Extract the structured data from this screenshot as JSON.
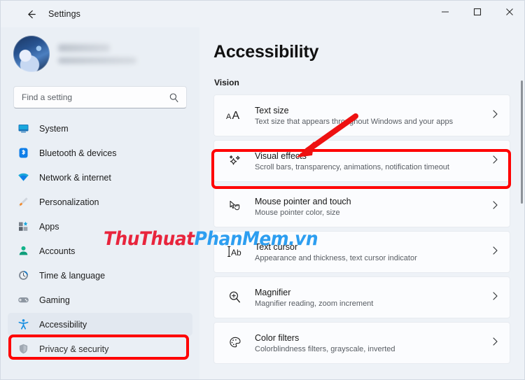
{
  "window": {
    "title": "Settings",
    "back_icon": "back-arrow-icon",
    "minimize": "─",
    "maximize": "□",
    "close": "✕"
  },
  "sidebar": {
    "profile": {
      "name": "",
      "email": "",
      "avatar": "user-avatar"
    },
    "search": {
      "placeholder": "Find a setting",
      "value": "",
      "icon": "search-icon"
    },
    "items": [
      {
        "label": "System",
        "icon": "monitor-icon",
        "selected": false
      },
      {
        "label": "Bluetooth & devices",
        "icon": "bluetooth-icon",
        "selected": false
      },
      {
        "label": "Network & internet",
        "icon": "wifi-icon",
        "selected": false
      },
      {
        "label": "Personalization",
        "icon": "paintbrush-icon",
        "selected": false
      },
      {
        "label": "Apps",
        "icon": "apps-icon",
        "selected": false
      },
      {
        "label": "Accounts",
        "icon": "person-icon",
        "selected": false
      },
      {
        "label": "Time & language",
        "icon": "clock-icon",
        "selected": false
      },
      {
        "label": "Gaming",
        "icon": "gamepad-icon",
        "selected": false
      },
      {
        "label": "Accessibility",
        "icon": "accessibility-icon",
        "selected": true
      },
      {
        "label": "Privacy & security",
        "icon": "shield-icon",
        "selected": false
      }
    ]
  },
  "main": {
    "page_title": "Accessibility",
    "section_label": "Vision",
    "cards": [
      {
        "title": "Text size",
        "subtitle": "Text size that appears throughout Windows and your apps",
        "icon": "text-size-icon"
      },
      {
        "title": "Visual effects",
        "subtitle": "Scroll bars, transparency, animations, notification timeout",
        "icon": "sparkles-icon"
      },
      {
        "title": "Mouse pointer and touch",
        "subtitle": "Mouse pointer color, size",
        "icon": "mouse-pointer-icon"
      },
      {
        "title": "Text cursor",
        "subtitle": "Appearance and thickness, text cursor indicator",
        "icon": "text-cursor-icon"
      },
      {
        "title": "Magnifier",
        "subtitle": "Magnifier reading, zoom increment",
        "icon": "magnifier-icon"
      },
      {
        "title": "Color filters",
        "subtitle": "Colorblindness filters, grayscale, inverted",
        "icon": "color-palette-icon"
      }
    ]
  },
  "annotations": {
    "highlight_color": "#ff0000",
    "boxes": [
      "visual-effects-card",
      "accessibility-sidebar-item"
    ],
    "arrow": "points-to-visual-effects"
  },
  "watermark": {
    "part1": "ThuThuat",
    "part2": "PhanMem.vn",
    "color1": "#e8243c",
    "color2": "#2d9ef0"
  }
}
